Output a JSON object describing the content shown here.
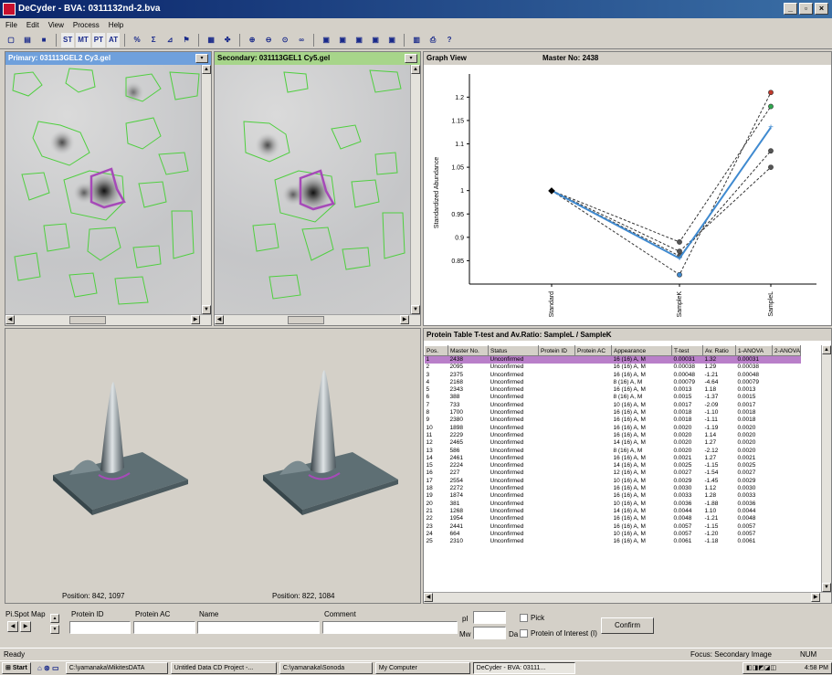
{
  "window": {
    "title": "DeCyder - BVA: 0311132nd-2.bva"
  },
  "menu": [
    "File",
    "Edit",
    "View",
    "Process",
    "Help"
  ],
  "toolbar": {
    "labels": [
      "ST",
      "MT",
      "PT",
      "AT"
    ]
  },
  "primary": {
    "title": "Primary: 031113GEL2 Cy3.gel",
    "position": "Position: 842, 1097"
  },
  "secondary": {
    "title": "Secondary: 031113GEL1 Cy5.gel",
    "position": "Position: 822, 1084"
  },
  "graph": {
    "title": "Graph View",
    "master": "Master No: 2438"
  },
  "chart_data": {
    "type": "line",
    "categories": [
      "Standard",
      "SampleK",
      "SampleL"
    ],
    "ylabel": "Standardized Abundance",
    "ylim": [
      0.8,
      1.23
    ],
    "yticks": [
      0.85,
      0.9,
      0.95,
      1,
      1.05,
      1.1,
      1.15,
      1.2
    ],
    "series": [
      {
        "values": [
          1,
          0.855,
          1.135
        ],
        "highlight": true
      },
      {
        "values": [
          1,
          0.82,
          1.21
        ]
      },
      {
        "values": [
          1,
          0.89,
          1.18
        ]
      },
      {
        "values": [
          1,
          0.86,
          1.085
        ]
      },
      {
        "values": [
          1,
          0.87,
          1.05
        ]
      }
    ]
  },
  "protein_table": {
    "title": "Protein Table    T-test and Av.Ratio: SampleL / SampleK",
    "columns": [
      "Pos.",
      "Master No.",
      "Status",
      "Protein ID",
      "Protein AC",
      "Appearance",
      "T-test",
      "Av. Ratio",
      "1-ANOVA",
      "2-ANOVA"
    ],
    "rows": [
      [
        "1",
        "2438",
        "Unconfirmed",
        "",
        "",
        "16 (16) A, M",
        "0.00031",
        "1.32",
        "0.00031"
      ],
      [
        "2",
        "2095",
        "Unconfirmed",
        "",
        "",
        "16 (16) A, M",
        "0.00038",
        "1.29",
        "0.00038"
      ],
      [
        "3",
        "2375",
        "Unconfirmed",
        "",
        "",
        "16 (16) A, M",
        "0.00048",
        "-1.21",
        "0.00048"
      ],
      [
        "4",
        "2168",
        "Unconfirmed",
        "",
        "",
        "8 (16) A, M",
        "0.00079",
        "-4.64",
        "0.00079"
      ],
      [
        "5",
        "2343",
        "Unconfirmed",
        "",
        "",
        "16 (16) A, M",
        "0.0013",
        "1.18",
        "0.0013"
      ],
      [
        "6",
        "388",
        "Unconfirmed",
        "",
        "",
        "8 (16) A, M",
        "0.0015",
        "-1.37",
        "0.0015"
      ],
      [
        "7",
        "733",
        "Unconfirmed",
        "",
        "",
        "10 (16) A, M",
        "0.0017",
        "-2.09",
        "0.0017"
      ],
      [
        "8",
        "1700",
        "Unconfirmed",
        "",
        "",
        "16 (16) A, M",
        "0.0018",
        "-1.10",
        "0.0018"
      ],
      [
        "9",
        "2380",
        "Unconfirmed",
        "",
        "",
        "16 (16) A, M",
        "0.0018",
        "-1.11",
        "0.0018"
      ],
      [
        "10",
        "1898",
        "Unconfirmed",
        "",
        "",
        "16 (16) A, M",
        "0.0020",
        "-1.19",
        "0.0020"
      ],
      [
        "11",
        "2229",
        "Unconfirmed",
        "",
        "",
        "16 (16) A, M",
        "0.0020",
        "1.14",
        "0.0020"
      ],
      [
        "12",
        "2465",
        "Unconfirmed",
        "",
        "",
        "14 (16) A, M",
        "0.0020",
        "1.27",
        "0.0020"
      ],
      [
        "13",
        "586",
        "Unconfirmed",
        "",
        "",
        "8 (16) A, M",
        "0.0020",
        "-2.12",
        "0.0020"
      ],
      [
        "14",
        "2461",
        "Unconfirmed",
        "",
        "",
        "16 (16) A, M",
        "0.0021",
        "1.27",
        "0.0021"
      ],
      [
        "15",
        "2224",
        "Unconfirmed",
        "",
        "",
        "14 (16) A, M",
        "0.0025",
        "-1.15",
        "0.0025"
      ],
      [
        "16",
        "227",
        "Unconfirmed",
        "",
        "",
        "12 (16) A, M",
        "0.0027",
        "-1.54",
        "0.0027"
      ],
      [
        "17",
        "2554",
        "Unconfirmed",
        "",
        "",
        "10 (16) A, M",
        "0.0029",
        "-1.45",
        "0.0029"
      ],
      [
        "18",
        "2272",
        "Unconfirmed",
        "",
        "",
        "16 (16) A, M",
        "0.0030",
        "1.12",
        "0.0030"
      ],
      [
        "19",
        "1874",
        "Unconfirmed",
        "",
        "",
        "16 (16) A, M",
        "0.0033",
        "1.28",
        "0.0033"
      ],
      [
        "20",
        "381",
        "Unconfirmed",
        "",
        "",
        "10 (16) A, M",
        "0.0036",
        "-1.88",
        "0.0036"
      ],
      [
        "21",
        "1268",
        "Unconfirmed",
        "",
        "",
        "14 (16) A, M",
        "0.0044",
        "1.10",
        "0.0044"
      ],
      [
        "22",
        "1954",
        "Unconfirmed",
        "",
        "",
        "16 (16) A, M",
        "0.0048",
        "-1.21",
        "0.0048"
      ],
      [
        "23",
        "2441",
        "Unconfirmed",
        "",
        "",
        "16 (16) A, M",
        "0.0057",
        "-1.15",
        "0.0057"
      ],
      [
        "24",
        "664",
        "Unconfirmed",
        "",
        "",
        "10 (16) A, M",
        "0.0057",
        "-1.20",
        "0.0057"
      ],
      [
        "25",
        "2310",
        "Unconfirmed",
        "",
        "",
        "16 (16) A, M",
        "0.0061",
        "-1.18",
        "0.0061"
      ]
    ]
  },
  "form": {
    "spot_map": "Pi.Spot Map",
    "protein_id": "Protein ID",
    "protein_ac": "Protein AC",
    "name": "Name",
    "comment": "Comment",
    "pi": "pI",
    "mw": "Mw",
    "da": "Da",
    "pick": "Pick",
    "poi": "Protein of Interest (I)",
    "confirm": "Confirm"
  },
  "status": {
    "left": "Ready",
    "focus": "Focus: Secondary Image",
    "num": "NUM"
  },
  "taskbar": {
    "start": "Start",
    "items": [
      "C:\\yamanaka\\MikitesDATA",
      "Untitled Data CD Project -...",
      "C:\\yamanaka\\Sonoda",
      "My Computer",
      "DeCyder - BVA: 03111..."
    ],
    "clock": "4:58 PM"
  },
  "colors": {
    "title_bar": "#0a246a",
    "primary_header": "#6fa0dc",
    "secondary_header": "#a7d58a",
    "highlight": "#b97fc9",
    "line_blue": "#3f8ad0"
  }
}
